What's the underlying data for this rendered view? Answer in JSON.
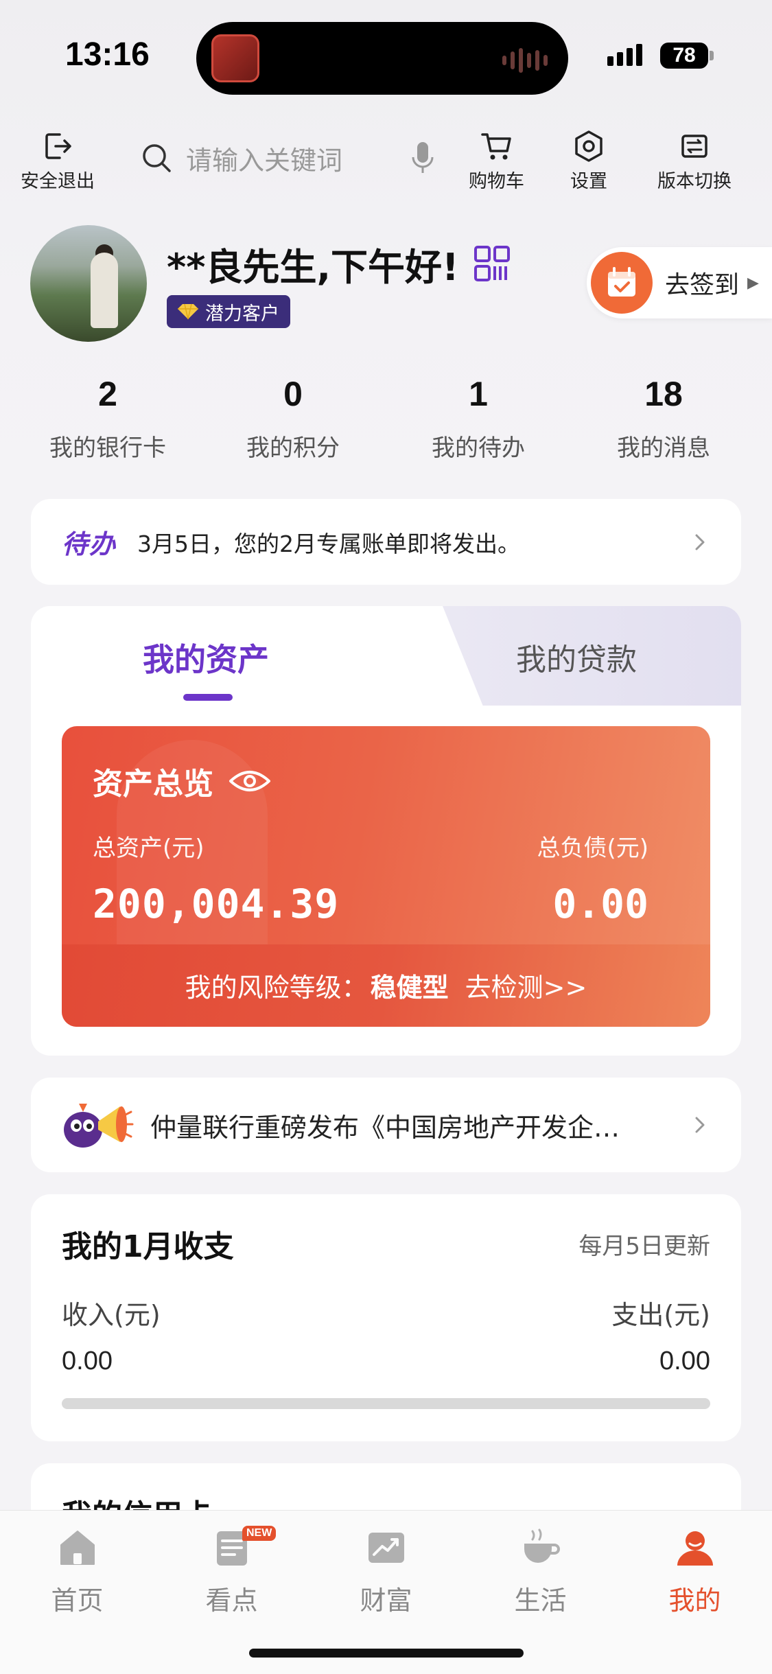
{
  "status_bar": {
    "time": "13:16",
    "battery": "78"
  },
  "header": {
    "logout_label": "安全退出",
    "search_placeholder": "请输入关键词",
    "cart_label": "购物车",
    "settings_label": "设置",
    "version_label": "版本切换"
  },
  "profile": {
    "greeting": "**良先生,下午好!",
    "badge": "潜力客户",
    "checkin_label": "去签到"
  },
  "stats": [
    {
      "value": "2",
      "label": "我的银行卡"
    },
    {
      "value": "0",
      "label": "我的积分"
    },
    {
      "value": "1",
      "label": "我的待办"
    },
    {
      "value": "18",
      "label": "我的消息"
    }
  ],
  "todo": {
    "tag": "待办",
    "text": "3月5日，您的2月专属账单即将发出。"
  },
  "assets": {
    "tabs": [
      {
        "label": "我的资产"
      },
      {
        "label": "我的贷款"
      }
    ],
    "overview_title": "资产总览",
    "total_assets_label": "总资产(元)",
    "total_assets_value": "200,004.39",
    "total_liabilities_label": "总负债(元)",
    "total_liabilities_value": "0.00",
    "risk_prefix": "我的风险等级：",
    "risk_level": "稳健型",
    "risk_link": "去检测>>"
  },
  "news": {
    "text": "仲量联行重磅发布《中国房地产开发企…"
  },
  "income": {
    "title": "我的1月收支",
    "update_note": "每月5日更新",
    "income_label": "收入(元)",
    "income_value": "0.00",
    "expense_label": "支出(元)",
    "expense_value": "0.00"
  },
  "credit": {
    "title": "我的信用卡"
  },
  "tabbar": {
    "items": [
      {
        "label": "首页",
        "icon": "home-icon"
      },
      {
        "label": "看点",
        "icon": "news-icon",
        "tag": "NEW"
      },
      {
        "label": "财富",
        "icon": "wealth-chart-icon"
      },
      {
        "label": "生活",
        "icon": "coffee-cup-icon"
      },
      {
        "label": "我的",
        "icon": "profile-icon"
      }
    ],
    "active_color": "#e4502c"
  },
  "colors": {
    "brand_purple": "#6c35c9",
    "card_red": "#e8503c",
    "accent_orange": "#f06a37"
  }
}
